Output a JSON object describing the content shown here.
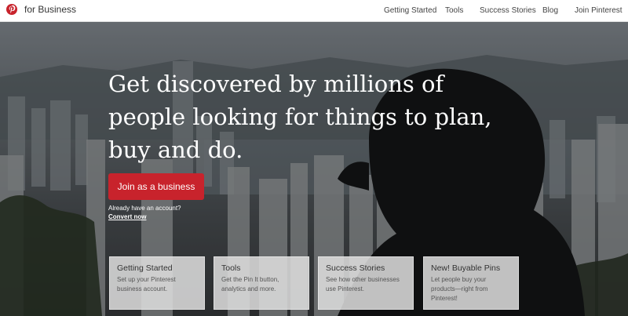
{
  "header": {
    "brand_label": "for Business",
    "nav": [
      {
        "label": "Getting Started"
      },
      {
        "label": "Tools"
      },
      {
        "label": "Success Stories"
      },
      {
        "label": "Blog"
      },
      {
        "label": "Join Pinterest"
      }
    ],
    "logo_icon": "pinterest-logo-icon"
  },
  "hero": {
    "headline_lines": [
      "Get discovered by millions of",
      "people looking for things to plan,",
      "buy and do."
    ],
    "cta_label": "Join as a business",
    "account_prompt": "Already have an account?",
    "convert_link": "Convert now"
  },
  "cards": [
    {
      "title": "Getting Started",
      "desc_lines": [
        "Set up your Pinterest",
        "business account."
      ]
    },
    {
      "title": "Tools",
      "desc_lines": [
        "Get the Pin It button,",
        "analytics and more."
      ]
    },
    {
      "title": "Success Stories",
      "desc_lines": [
        "See how other businesses",
        "use Pinterest."
      ]
    },
    {
      "title": "New! Buyable Pins",
      "desc_lines": [
        "Let people buy your",
        "products—right from",
        "Pinterest!"
      ]
    }
  ],
  "colors": {
    "brand_red": "#c8232c",
    "nav_text": "#444444",
    "card_bg": "#dedede"
  }
}
